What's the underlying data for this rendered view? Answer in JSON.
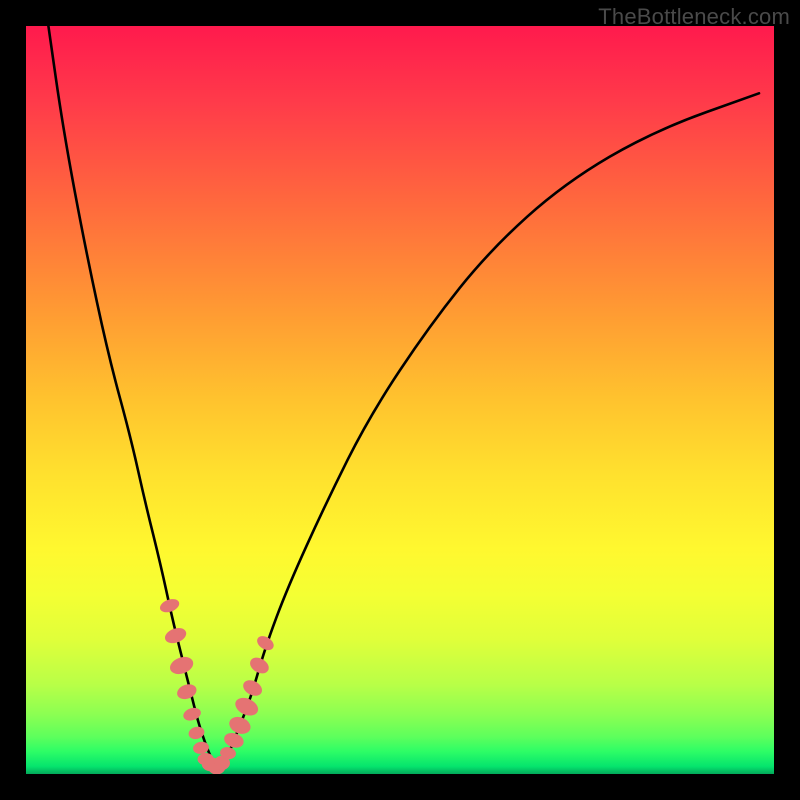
{
  "watermark": "TheBottleneck.com",
  "colors": {
    "frame": "#000000",
    "curve": "#000000",
    "marker_fill": "#e57373",
    "marker_stroke": "#c85a5a"
  },
  "chart_data": {
    "type": "line",
    "title": "",
    "xlabel": "",
    "ylabel": "",
    "xlim": [
      0,
      100
    ],
    "ylim": [
      0,
      100
    ],
    "series": [
      {
        "name": "bottleneck-curve",
        "x": [
          3,
          5,
          8,
          11,
          14,
          16,
          18,
          19.5,
          21,
          22,
          23,
          24,
          25,
          26,
          27,
          28,
          30,
          32,
          35,
          40,
          46,
          54,
          62,
          72,
          84,
          98
        ],
        "y": [
          100,
          86,
          70,
          56,
          45,
          36,
          28,
          21,
          15,
          11,
          7,
          4,
          1.5,
          1,
          2.5,
          5,
          10,
          17,
          25,
          36,
          48,
          60,
          70,
          79,
          86,
          91
        ]
      }
    ],
    "markers": {
      "name": "highlight-points",
      "x": [
        19.2,
        20.0,
        20.8,
        21.5,
        22.2,
        22.8,
        23.4,
        24.0,
        24.7,
        25.5,
        26.2,
        27.0,
        27.8,
        28.6,
        29.5,
        30.3,
        31.2,
        32.0
      ],
      "y": [
        22.5,
        18.5,
        14.5,
        11.0,
        8.0,
        5.5,
        3.5,
        2.0,
        1.3,
        1.0,
        1.5,
        2.8,
        4.5,
        6.5,
        9.0,
        11.5,
        14.5,
        17.5
      ],
      "rx": [
        6,
        7,
        8,
        7,
        6,
        6,
        6,
        6,
        7,
        8,
        7,
        6,
        7,
        8,
        8,
        7,
        7,
        6
      ],
      "ry": [
        10,
        11,
        12,
        10,
        9,
        8,
        8,
        8,
        9,
        9,
        8,
        8,
        10,
        11,
        12,
        10,
        10,
        9
      ],
      "rot": [
        70,
        70,
        70,
        70,
        72,
        75,
        80,
        85,
        90,
        90,
        95,
        100,
        108,
        112,
        115,
        118,
        120,
        122
      ]
    }
  }
}
